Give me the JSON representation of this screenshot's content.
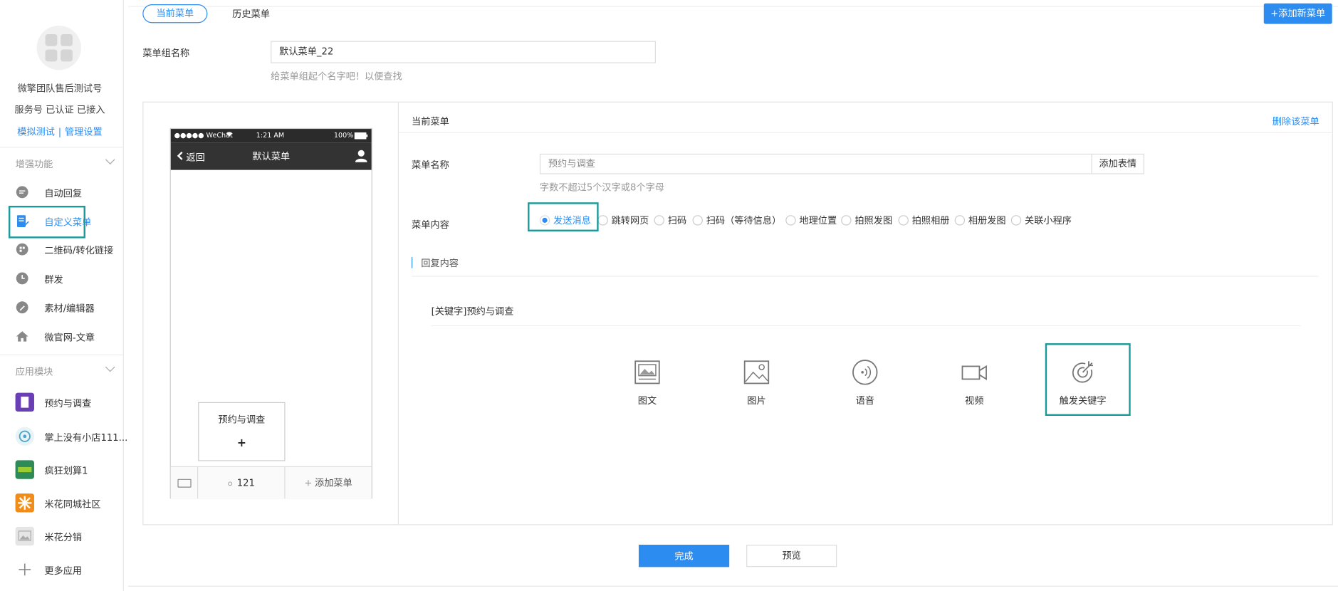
{
  "sidebar": {
    "account_name": "微擎团队售后测试号",
    "account_status": "服务号 已认证 已接入",
    "link_simulate": "模拟测试",
    "link_sep": "|",
    "link_manage": "管理设置",
    "section_enhance": "增强功能",
    "enhance_items": [
      {
        "label": "自动回复"
      },
      {
        "label": "自定义菜单"
      },
      {
        "label": "二维码/转化链接"
      },
      {
        "label": "群发"
      },
      {
        "label": "素材/编辑器"
      },
      {
        "label": "微官网-文章"
      }
    ],
    "section_apps": "应用模块",
    "app_items": [
      {
        "label": "预约与调查",
        "color": "#6a3fb5"
      },
      {
        "label": "掌上没有小店111...",
        "color": "#4aa7c9"
      },
      {
        "label": "疯狂划算1",
        "color": "#2e8b57"
      },
      {
        "label": "米花同城社区",
        "color": "#f08c1a"
      },
      {
        "label": "米花分销",
        "color": "#bbbbbb"
      },
      {
        "label": "更多应用",
        "color": "#888888"
      }
    ]
  },
  "tabs": {
    "current": "当前菜单",
    "history": "历史菜单"
  },
  "add_menu_button": "+添加新菜单",
  "group": {
    "label": "菜单组名称",
    "value": "默认菜单_22",
    "hint": "给菜单组起个名字吧！以便查找"
  },
  "phone": {
    "carrier": "●●●●● WeChat",
    "time": "1:21 AM",
    "battery": "100%",
    "back": "返回",
    "title": "默认菜单",
    "submenu_label": "预约与调查",
    "submenu_plus": "+",
    "menu_item": "121",
    "add_menu": "添加菜单"
  },
  "editor": {
    "title": "当前菜单",
    "delete": "删除该菜单",
    "name_label": "菜单名称",
    "name_value": "预约与调查",
    "emoji_button": "添加表情",
    "name_hint": "字数不超过5个汉字或8个字母",
    "content_label": "菜单内容",
    "content_options": [
      {
        "label": "发送消息",
        "selected": true
      },
      {
        "label": "跳转网页",
        "selected": false
      },
      {
        "label": "扫码",
        "selected": false
      },
      {
        "label": "扫码（等待信息）",
        "selected": false
      },
      {
        "label": "地理位置",
        "selected": false
      },
      {
        "label": "拍照发图",
        "selected": false
      },
      {
        "label": "拍照相册",
        "selected": false
      },
      {
        "label": "相册发图",
        "selected": false
      },
      {
        "label": "关联小程序",
        "selected": false
      }
    ],
    "reply_title": "回复内容",
    "keyword_text": "[关键字]预约与调查",
    "reply_types": [
      {
        "label": "图文",
        "icon": "news-icon"
      },
      {
        "label": "图片",
        "icon": "image-icon"
      },
      {
        "label": "语音",
        "icon": "voice-icon"
      },
      {
        "label": "视频",
        "icon": "video-icon"
      },
      {
        "label": "触发关键字",
        "icon": "keyword-trigger-icon"
      }
    ]
  },
  "footer": {
    "done": "完成",
    "preview": "预览"
  },
  "colors": {
    "accent": "#2d8cf0",
    "highlight": "#1a9a9a"
  }
}
